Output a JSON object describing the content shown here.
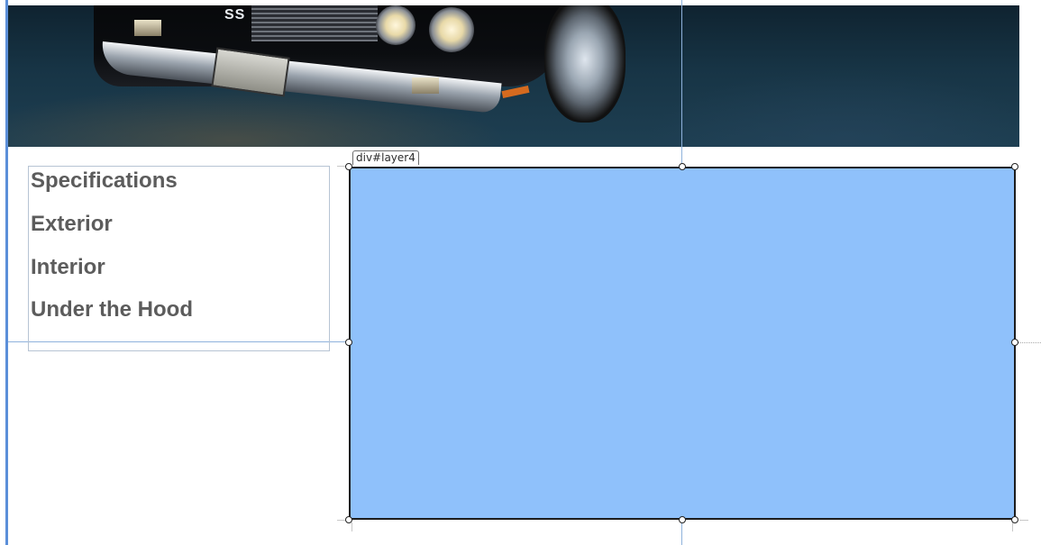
{
  "header": {
    "image_alt": "Black muscle car front view",
    "badge_text": "SS"
  },
  "sidebar": {
    "items": [
      {
        "label": "Specifications"
      },
      {
        "label": "Exterior"
      },
      {
        "label": "Interior"
      },
      {
        "label": "Under the Hood"
      }
    ]
  },
  "selection": {
    "tag_label": "div#layer4",
    "fill_color": "#8fc1fb",
    "border_color": "#1d1d1d"
  },
  "colors": {
    "nav_text": "#5c5c5c",
    "guide": "#8fb2dc",
    "left_edge": "#5b8fd9"
  }
}
